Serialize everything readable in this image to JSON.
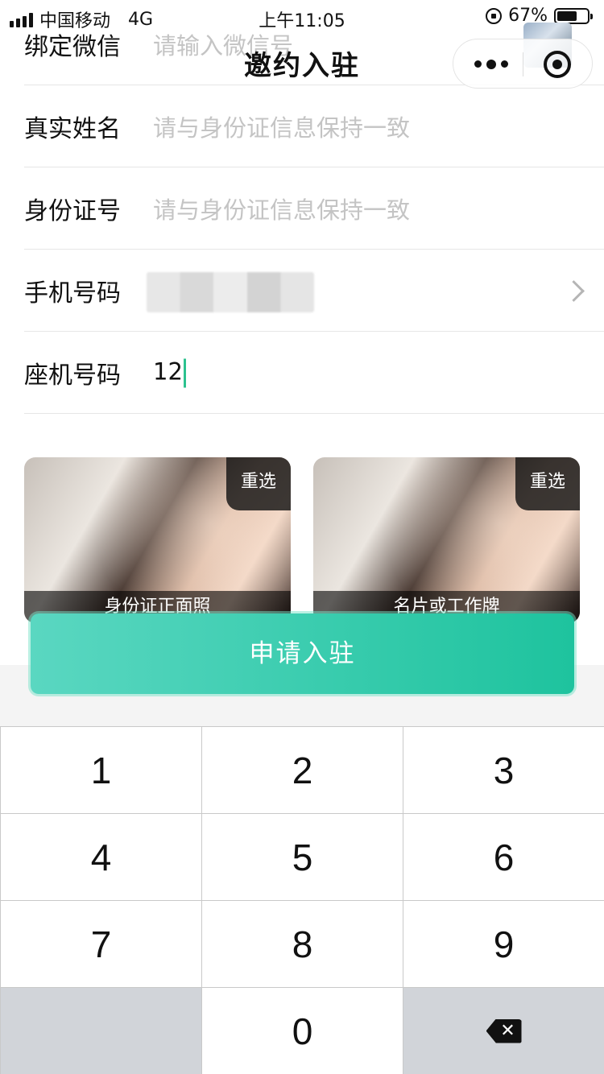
{
  "status_bar": {
    "carrier": "中国移动",
    "network": "4G",
    "time": "上午11:05",
    "battery_text": "67%",
    "battery_level": 0.67
  },
  "nav": {
    "title": "邀约入驻"
  },
  "form": {
    "rows": [
      {
        "label": "绑定微信",
        "placeholder": "请输入微信号",
        "value": ""
      },
      {
        "label": "真实姓名",
        "placeholder": "请与身份证信息保持一致",
        "value": ""
      },
      {
        "label": "身份证号",
        "placeholder": "请与身份证信息保持一致",
        "value": ""
      },
      {
        "label": "手机号码",
        "placeholder": "",
        "value": ""
      },
      {
        "label": "座机号码",
        "placeholder": "",
        "value": "12"
      }
    ]
  },
  "uploads": [
    {
      "reselect_label": "重选",
      "caption": "身份证正面照"
    },
    {
      "reselect_label": "重选",
      "caption": "名片或工作牌"
    }
  ],
  "submit": {
    "label": "申请入驻",
    "color_start": "#5ad7c1",
    "color_end": "#1ec39e"
  },
  "keypad": {
    "keys": [
      "1",
      "2",
      "3",
      "4",
      "5",
      "6",
      "7",
      "8",
      "9",
      "",
      "0",
      ""
    ]
  }
}
